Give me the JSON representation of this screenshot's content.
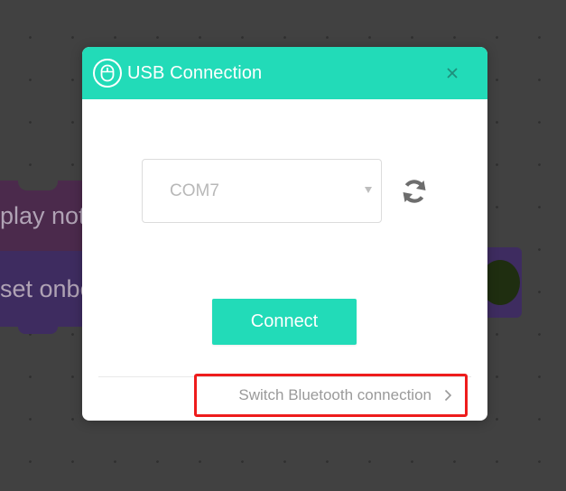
{
  "background": {
    "block_play_text": "play not",
    "block_set_text": "set onbo"
  },
  "dialog": {
    "title": "USB Connection",
    "header_icon": "mouse-icon",
    "close_icon": "close-icon",
    "port_select": {
      "value": "COM7"
    },
    "refresh_icon": "refresh-icon",
    "connect_label": "Connect",
    "switch_label": "Switch Bluetooth connection",
    "switch_icon": "chevron-right-icon"
  },
  "colors": {
    "accent": "#22dbb8",
    "highlight_border": "#ee1c1c"
  }
}
